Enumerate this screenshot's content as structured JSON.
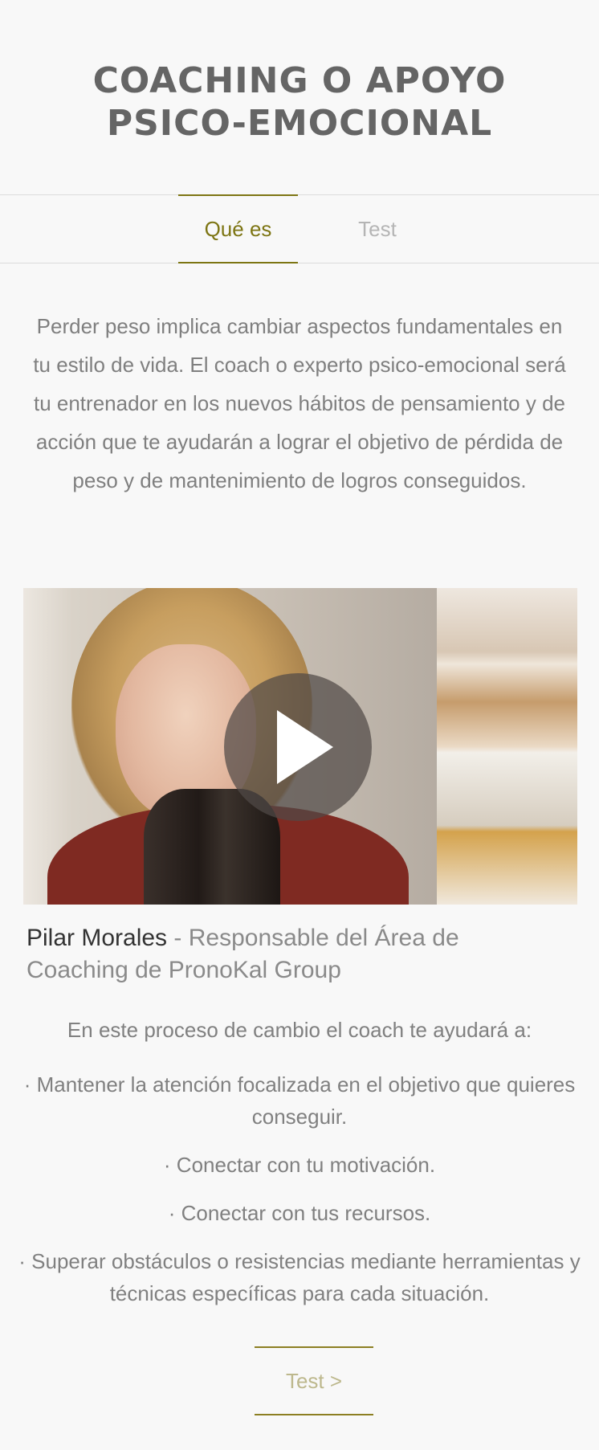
{
  "header": {
    "title_line1": "COACHING O APOYO",
    "title_line2": "PSICO-EMOCIONAL"
  },
  "tabs": [
    {
      "label": "Qué es",
      "active": true
    },
    {
      "label": "Test",
      "active": false
    }
  ],
  "intro": {
    "text": "Perder peso implica cambiar aspectos fundamentales en tu estilo de vida. El coach o experto psico-emocional será tu entrenador en los nuevos hábitos de pensamiento y de acción que te ayudarán a lograr el objetivo de pérdida de peso y de mantenimiento de logros conseguidos."
  },
  "video": {
    "play_icon": "play-icon"
  },
  "caption": {
    "name": "Pilar Morales",
    "role": " - Responsable del Área de Coaching de PronoKal Group"
  },
  "lead": "En este proceso de cambio el coach te ayudará a:",
  "bullets": [
    "· Mantener la atención focalizada en el objetivo que quieres conseguir.",
    "· Conectar con tu motivación.",
    "· Conectar con tus recursos.",
    "· Superar obstáculos o resistencias mediante herramientas y técnicas específicas para cada situación."
  ],
  "cta": {
    "label": "Test >"
  },
  "colors": {
    "accent": "#7d7513",
    "background": "#f8f8f8",
    "title": "#656565",
    "text": "#808080"
  }
}
